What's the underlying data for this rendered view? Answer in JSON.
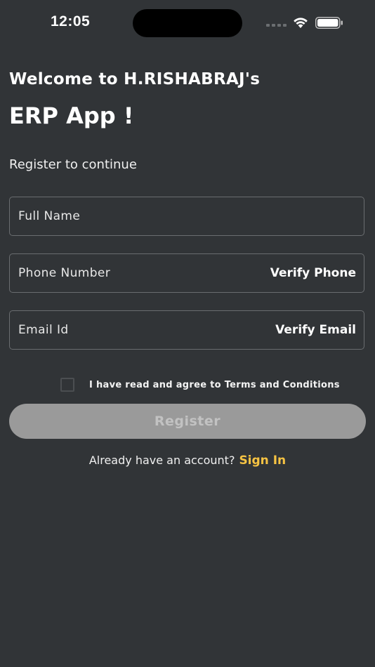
{
  "status_bar": {
    "time": "12:05",
    "icons": [
      "signal-icon",
      "wifi-icon",
      "battery-icon"
    ]
  },
  "header": {
    "welcome": "Welcome to H.RISHABRAJ's",
    "title": "ERP App !",
    "subtitle": "Register to continue"
  },
  "form": {
    "full_name": {
      "placeholder": "Full Name"
    },
    "phone": {
      "placeholder": "Phone Number",
      "action": "Verify Phone"
    },
    "email": {
      "placeholder": "Email Id",
      "action": "Verify Email"
    },
    "terms": {
      "label": "I have read and agree to Terms and Conditions",
      "checked": false
    },
    "register_label": "Register"
  },
  "footer": {
    "question": "Already have an account?",
    "signin_label": "Sign In"
  },
  "colors": {
    "background": "#313437",
    "accent": "#f6c343",
    "button_disabled": "#9a9a9a"
  }
}
